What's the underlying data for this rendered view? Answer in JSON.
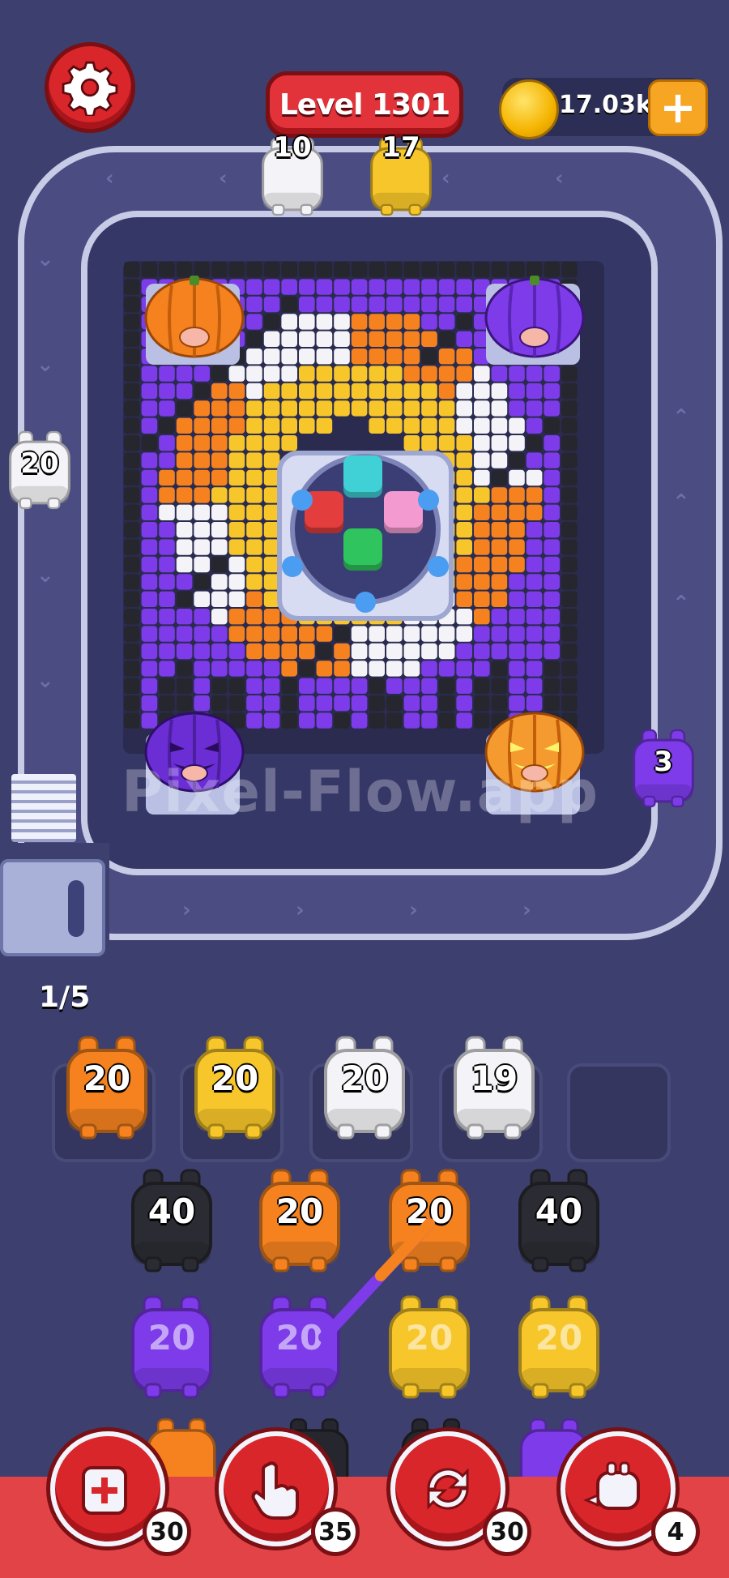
{
  "header": {
    "level_label": "Level 1301",
    "coins": "17.03k"
  },
  "track_pigs": [
    {
      "count": "10",
      "color": "#f4f4f8"
    },
    {
      "count": "17",
      "color": "#f7c62a"
    },
    {
      "count": "20",
      "color": "#f4f4f8"
    },
    {
      "count": "3",
      "color": "#7d3bea"
    }
  ],
  "watermark": "Pixel-Flow.app",
  "progress": "1/5",
  "queue_row1": [
    {
      "count": "20",
      "color": "#f5821f"
    },
    {
      "count": "20",
      "color": "#f7c62a"
    },
    {
      "count": "20",
      "color": "#f4f4f8"
    },
    {
      "count": "19",
      "color": "#f4f4f8"
    }
  ],
  "queue_row2": [
    {
      "count": "40",
      "color": "#2b2b33"
    },
    {
      "count": "20",
      "color": "#f5821f"
    },
    {
      "count": "20",
      "color": "#f5821f"
    },
    {
      "count": "40",
      "color": "#2b2b33"
    }
  ],
  "queue_row3": [
    {
      "count": "20",
      "color": "#7d3bea"
    },
    {
      "count": "20",
      "color": "#7d3bea"
    },
    {
      "count": "20",
      "color": "#f7c62a"
    },
    {
      "count": "20",
      "color": "#f7c62a"
    }
  ],
  "powerups": [
    {
      "name": "add-slot",
      "count": "30"
    },
    {
      "name": "tap",
      "count": "35"
    },
    {
      "name": "shuffle",
      "count": "30"
    },
    {
      "name": "pig-train",
      "count": "4"
    }
  ],
  "center_blocks": [
    "#e33d3d",
    "#3fd1d6",
    "#f39ad0",
    "#2fc45e"
  ],
  "colors": {
    "purple": "#7d3bea",
    "orange": "#f5821f",
    "yellow": "#f7c62a",
    "white": "#f4f4f8",
    "black": "#26262e"
  }
}
